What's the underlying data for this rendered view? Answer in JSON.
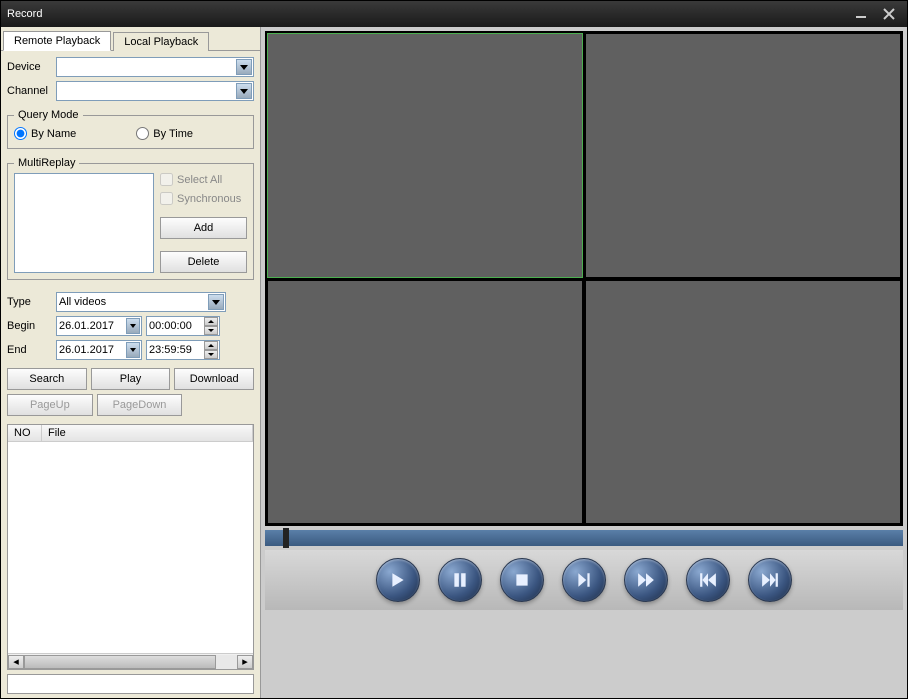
{
  "window": {
    "title": "Record"
  },
  "tabs": {
    "remote": "Remote Playback",
    "local": "Local Playback"
  },
  "labels": {
    "device": "Device",
    "channel": "Channel",
    "queryMode": "Query Mode",
    "byName": "By Name",
    "byTime": "By Time",
    "multiReplay": "MultiReplay",
    "selectAll": "Select All",
    "synchronous": "Synchronous",
    "add": "Add",
    "delete": "Delete",
    "type": "Type",
    "begin": "Begin",
    "end": "End",
    "search": "Search",
    "play": "Play",
    "download": "Download",
    "pageUp": "PageUp",
    "pageDown": "PageDown",
    "colNo": "NO",
    "colFile": "File"
  },
  "values": {
    "device": "",
    "channel": "",
    "type": "All videos",
    "beginDate": "26.01.2017",
    "beginTime": "00:00:00",
    "endDate": "26.01.2017",
    "endTime": "23:59:59"
  },
  "controls": {
    "play": "play-icon",
    "pause": "pause-icon",
    "stop": "stop-icon",
    "slow": "slow-icon",
    "fast": "fast-icon",
    "prev": "prev-icon",
    "next": "next-icon"
  }
}
